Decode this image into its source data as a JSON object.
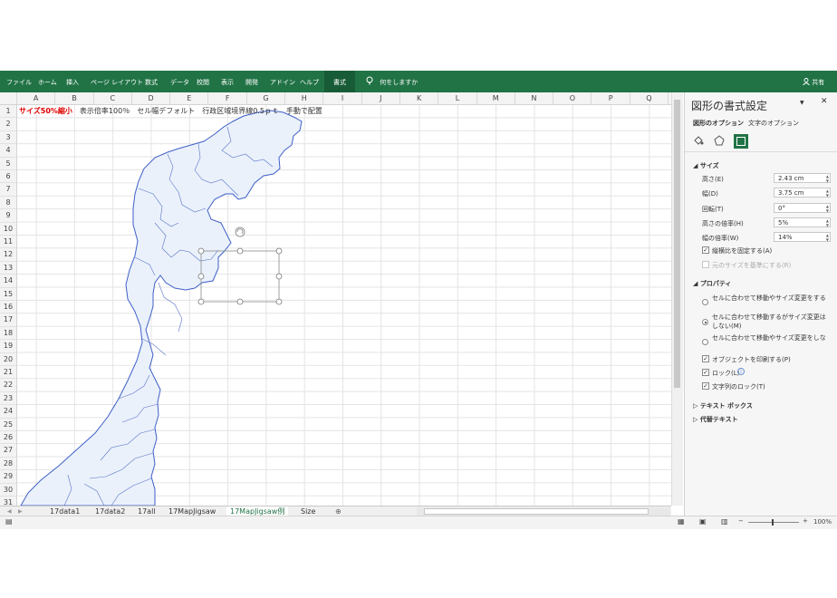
{
  "ribbon": {
    "tabs": [
      "ファイル",
      "ホーム",
      "挿入",
      "ページ レイアウト",
      "数式",
      "データ",
      "校閲",
      "表示",
      "開発",
      "アドイン",
      "ヘルプ",
      "書式"
    ],
    "active_tab": "書式",
    "tell_me": "何をしますか",
    "share": "共有",
    "color": "#217346"
  },
  "grid": {
    "columns": [
      "A",
      "B",
      "C",
      "D",
      "E",
      "F",
      "G",
      "H",
      "I",
      "J",
      "K",
      "L",
      "M",
      "N",
      "O",
      "P",
      "Q"
    ],
    "rows": [
      "1",
      "2",
      "3",
      "4",
      "5",
      "6",
      "7",
      "8",
      "9",
      "10",
      "11",
      "12",
      "13",
      "14",
      "15",
      "16",
      "17",
      "18",
      "19",
      "20",
      "21",
      "22",
      "23",
      "24",
      "25",
      "26",
      "27",
      "28",
      "29",
      "30",
      "31"
    ],
    "a1_red": "サイズ50%縮小",
    "a1_rest": "　表示倍率100％　セル幅デフォルト　行政区域境界線0.5ｐｔ　手動で配置"
  },
  "sheet_tabs": [
    "17data1",
    "17data2",
    "17all",
    "17MapJigsaw",
    "17MapJigsaw例",
    "Size"
  ],
  "active_sheet": "17MapJigsaw例",
  "status": {
    "zoom": "100%"
  },
  "pane": {
    "title": "図形の書式設定",
    "tabs": [
      "図形のオプション",
      "文字のオプション"
    ],
    "size_section": "サイズ",
    "fields": [
      {
        "label": "高さ(E)",
        "value": "2.43 cm"
      },
      {
        "label": "幅(D)",
        "value": "3.75 cm"
      },
      {
        "label": "回転(T)",
        "value": "0°"
      },
      {
        "label": "高さの倍率(H)",
        "value": "5%"
      },
      {
        "label": "幅の倍率(W)",
        "value": "14%"
      }
    ],
    "lock_aspect": "縦横比を固定する(A)",
    "relative_original": "元のサイズを基準にする(R)",
    "properties_section": "プロパティ",
    "radio1": "セルに合わせて移動やサイズ変更をする(S)",
    "radio2": "セルに合わせて移動するがサイズ変更はしない(M)",
    "radio3": "セルに合わせて移動やサイズ変更をしない(D)",
    "print_object": "オブジェクトを印刷する(P)",
    "lock": "ロック(L)",
    "lock_text": "文字列のロック(T)",
    "textbox_section": "テキスト ボックス",
    "alt_text_section": "代替テキスト"
  },
  "colors": {
    "map_fill": "#eaf1fb",
    "map_border": "#3f5fc8",
    "sheet_tab_active": "#217346",
    "note_red": "#e00000"
  }
}
